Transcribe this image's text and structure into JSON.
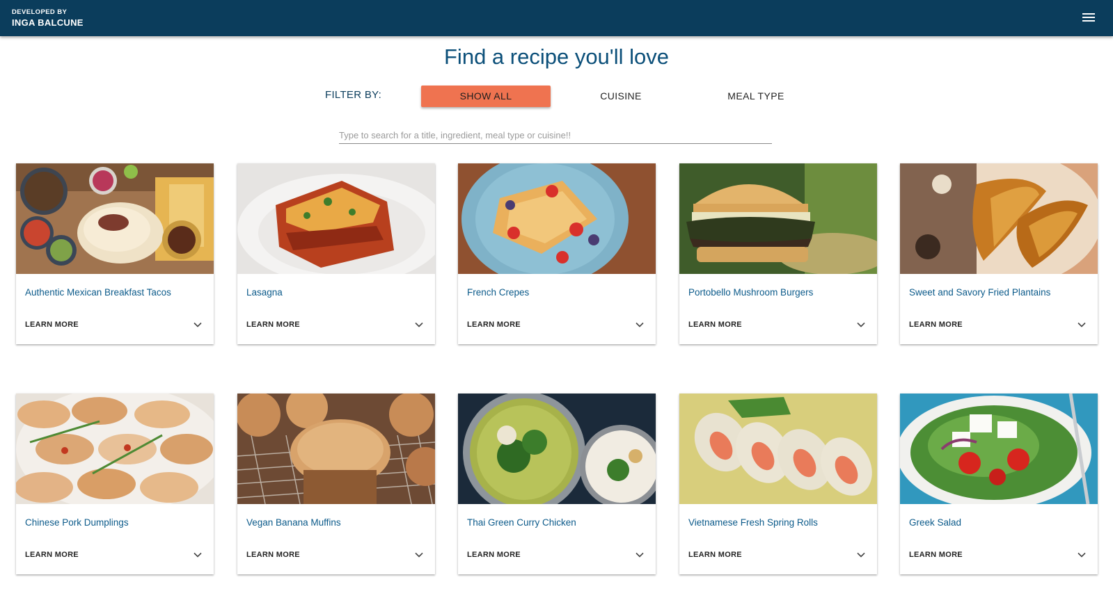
{
  "header": {
    "developed_by": "DEVELOPED BY",
    "developer_name": "INGA BALCUNE",
    "menu_icon": "hamburger-menu-icon"
  },
  "page_title": "Find a recipe you'll love",
  "filters": {
    "label": "FILTER BY:",
    "options": [
      "SHOW ALL",
      "CUISINE",
      "MEAL TYPE"
    ],
    "active": "SHOW ALL",
    "accent_color": "#ef7350"
  },
  "search": {
    "placeholder": "Type to search for a title, ingredient, meal type or cuisine!!",
    "value": ""
  },
  "recipes": [
    {
      "title": "Authentic Mexican Breakfast Tacos",
      "action": "LEARN MORE"
    },
    {
      "title": "Lasagna",
      "action": "LEARN MORE"
    },
    {
      "title": "French Crepes",
      "action": "LEARN MORE"
    },
    {
      "title": "Portobello Mushroom Burgers",
      "action": "LEARN MORE"
    },
    {
      "title": "Sweet and Savory Fried Plantains",
      "action": "LEARN MORE"
    },
    {
      "title": "Chinese Pork Dumplings",
      "action": "LEARN MORE"
    },
    {
      "title": "Vegan Banana Muffins",
      "action": "LEARN MORE"
    },
    {
      "title": "Thai Green Curry Chicken",
      "action": "LEARN MORE"
    },
    {
      "title": "Vietnamese Fresh Spring Rolls",
      "action": "LEARN MORE"
    },
    {
      "title": "Greek Salad",
      "action": "LEARN MORE"
    }
  ],
  "colors": {
    "appbar": "#0b3d5c",
    "title": "#0b4f79",
    "card_title": "#0b5a8a"
  }
}
